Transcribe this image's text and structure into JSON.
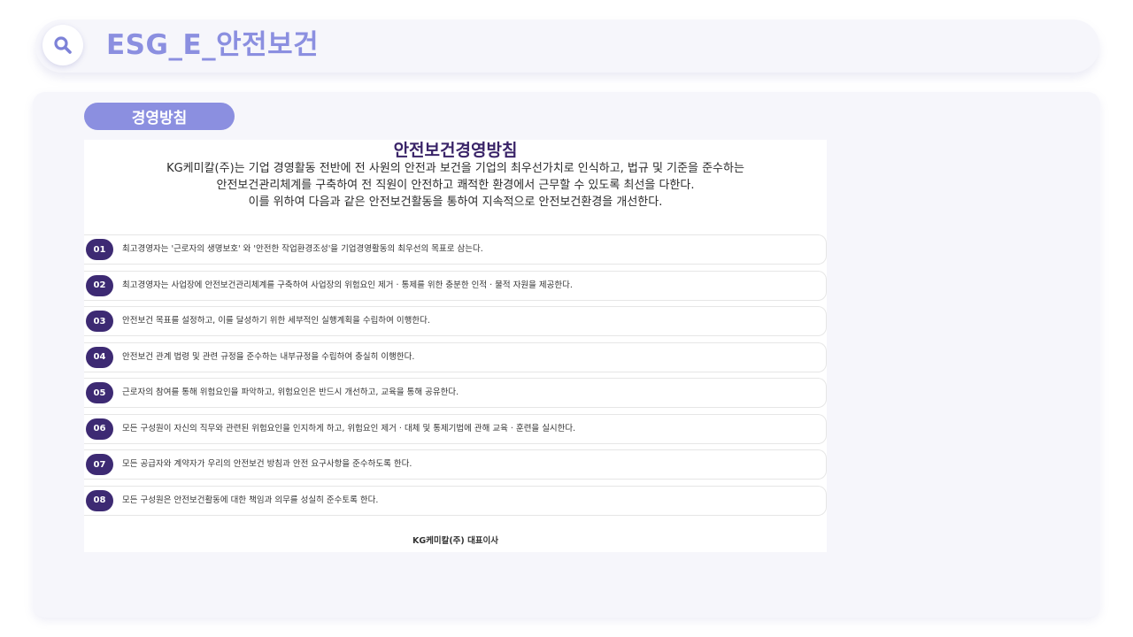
{
  "header": {
    "title": "ESG_E_안전보건",
    "icon": "search-icon"
  },
  "section": {
    "label": "경영방침"
  },
  "document": {
    "title": "안전보건경영방침",
    "intro_lines": [
      "KG케미칼(주)는 기업 경영활동 전반에 전 사원의 안전과 보건을 기업의 최우선가치로 인식하고, 법규 및 기준을 준수하는",
      "안전보건관리체계를 구축하여 전 직원이 안전하고 쾌적한 환경에서 근무할 수 있도록 최선을 다한다.",
      "이를 위하여 다음과 같은 안전보건활동을 통하여 지속적으로 안전보건환경을 개선한다."
    ],
    "items": [
      {
        "num": "01",
        "text": "최고경영자는 '근로자의 생명보호' 와 '안전한 작업환경조성'을 기업경영활동의 최우선의 목표로 삼는다."
      },
      {
        "num": "02",
        "text": "최고경영자는 사업장에 안전보건관리체계를 구축하여 사업장의 위험요인 제거 · 통제를 위한 충분한 인적 · 물적 자원을 제공한다."
      },
      {
        "num": "03",
        "text": "안전보건 목표를 설정하고, 이를 달성하기 위한 세부적인 실행계획을 수립하여 이행한다."
      },
      {
        "num": "04",
        "text": "안전보건 관계 법령 및 관련 규정을 준수하는 내부규정을 수립하여 충실히 이행한다."
      },
      {
        "num": "05",
        "text": "근로자의 참여를 통해 위험요인을 파악하고, 위험요인은 반드시 개선하고, 교육을 통해 공유한다."
      },
      {
        "num": "06",
        "text": "모든 구성원이 자신의 직무와 관련된 위험요인을 인지하게 하고, 위험요인 제거 · 대체 및 통제기법에 관해 교육 · 훈련을 실시한다."
      },
      {
        "num": "07",
        "text": "모든 공급자와 계약자가 우리의 안전보건 방침과 안전 요구사항을 준수하도록 한다."
      },
      {
        "num": "08",
        "text": "모든 구성원은 안전보건활동에 대한 책임과 의무를 성실히 준수토록 한다."
      }
    ],
    "signature": "KG케미칼(주) 대표이사"
  },
  "colors": {
    "accent": "#8b8fe0",
    "badge": "#3d2a73",
    "title": "#3a2468",
    "panel": "#f6f6fb"
  }
}
